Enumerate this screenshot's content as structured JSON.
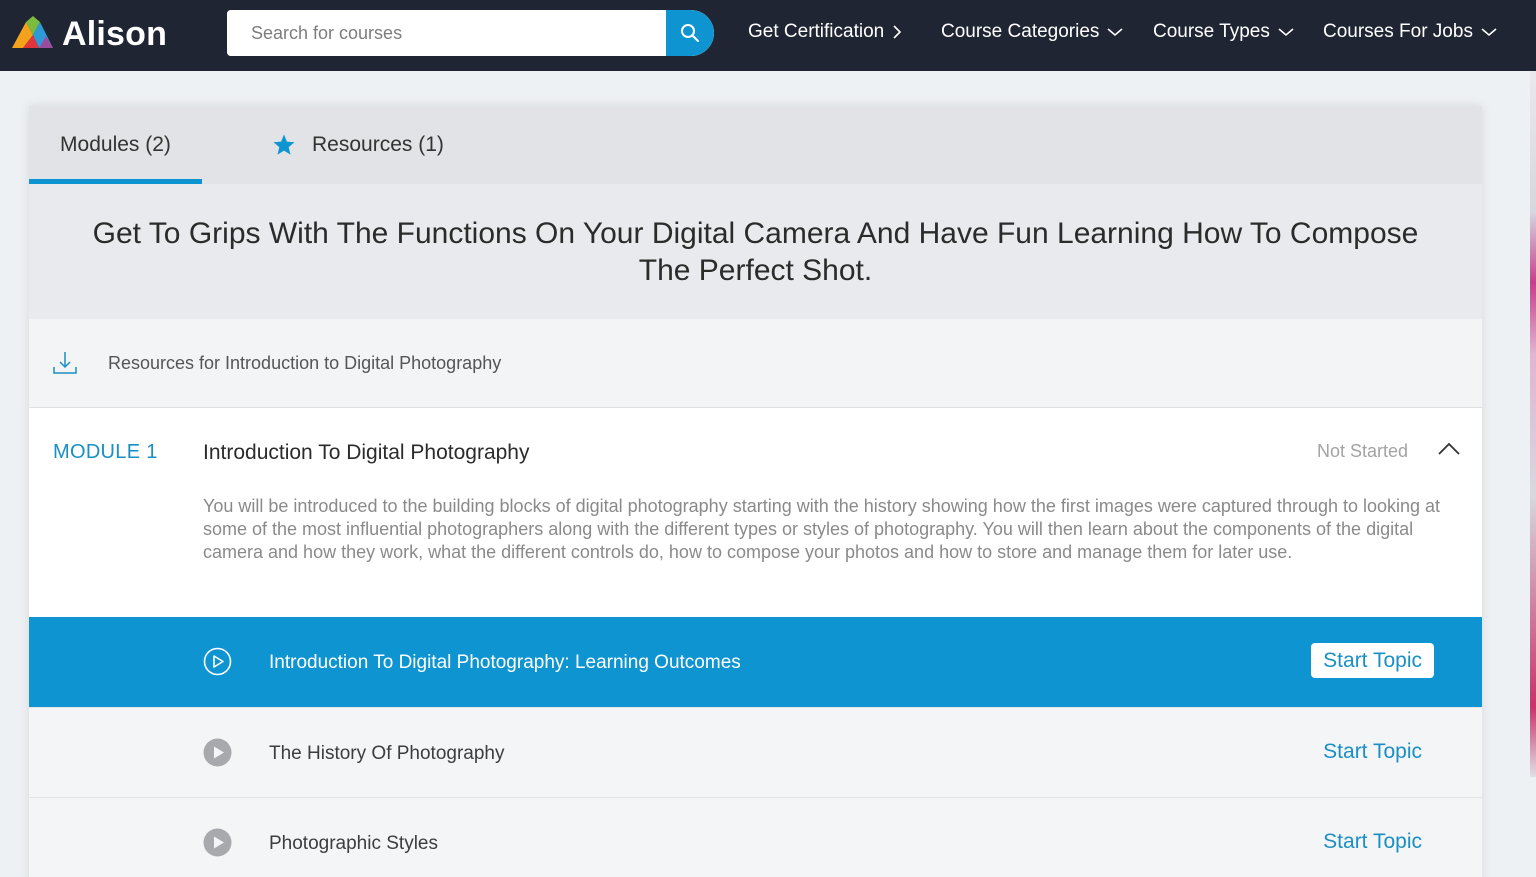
{
  "brand": {
    "name": "Alison",
    "colors": {
      "nav_bg": "#1f2533",
      "accent": "#0e95d1"
    }
  },
  "search": {
    "placeholder": "Search for courses",
    "icon": "search-icon"
  },
  "nav": {
    "items": [
      {
        "label": "Get Certification",
        "icon": "chevron-right-icon"
      },
      {
        "label": "Course Categories",
        "icon": "chevron-down-icon"
      },
      {
        "label": "Course Types",
        "icon": "chevron-down-icon"
      },
      {
        "label": "Courses For Jobs",
        "icon": "chevron-down-icon"
      }
    ]
  },
  "tabs": [
    {
      "label": "Modules (2)",
      "active": true
    },
    {
      "label": "Resources (1)",
      "active": false,
      "icon": "star-icon"
    }
  ],
  "headline": "Get To Grips With The Functions On Your Digital Camera And Have Fun Learning How To Compose The Perfect Shot.",
  "resources": {
    "label": "Resources for Introduction to Digital Photography",
    "icon": "download-icon"
  },
  "module": {
    "number": "MODULE 1",
    "title": "Introduction To Digital Photography",
    "status": "Not Started",
    "description": "You will be introduced to the building blocks of digital photography starting with the history showing how the first images were captured through to looking at some of the most influential photographers along with the different types or styles of photography. You will then learn about the components of the digital camera and how they work, what the different controls do, how to compose your photos and how to store and manage them for later use.",
    "topics": [
      {
        "title": "Introduction To Digital Photography: Learning Outcomes",
        "button": "Start Topic",
        "active": true
      },
      {
        "title": "The History Of Photography",
        "button": "Start Topic",
        "active": false
      },
      {
        "title": "Photographic Styles",
        "button": "Start Topic",
        "active": false
      }
    ]
  }
}
